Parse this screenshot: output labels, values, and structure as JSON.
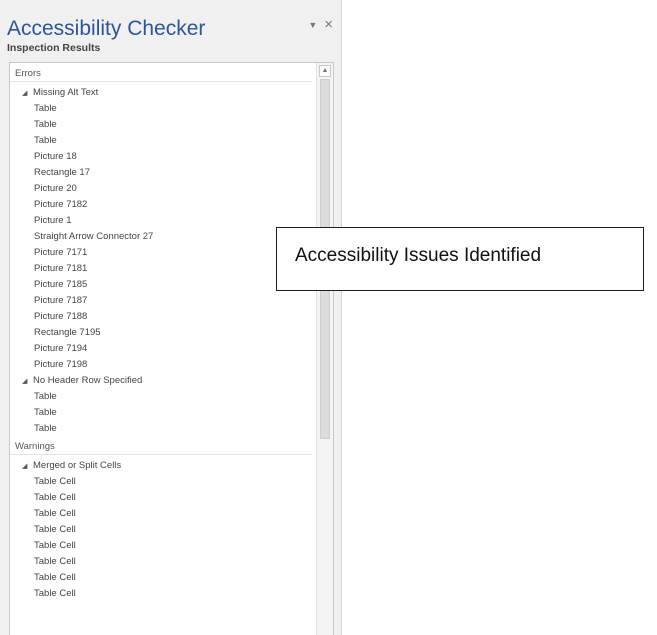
{
  "pane": {
    "title": "Accessibility Checker",
    "dropdown_icon": "chevron-down-icon",
    "close_icon": "close-icon",
    "subtitle": "Inspection Results"
  },
  "errors": {
    "header": "Errors",
    "groups": [
      {
        "label": "Missing Alt Text",
        "items": [
          "Table",
          "Table",
          "Table",
          "Picture 18",
          "Rectangle 17",
          "Picture 20",
          "Picture 7182",
          "Picture 1",
          "Straight Arrow Connector 27",
          "Picture 7171",
          "Picture 7181",
          "Picture 7185",
          "Picture 7187",
          "Picture 7188",
          "Rectangle 7195",
          "Picture 7194",
          "Picture 7198"
        ]
      },
      {
        "label": "No Header Row Specified",
        "items": [
          "Table",
          "Table",
          "Table"
        ]
      }
    ]
  },
  "warnings": {
    "header": "Warnings",
    "groups": [
      {
        "label": "Merged or Split Cells",
        "items": [
          "Table Cell",
          "Table Cell",
          "Table Cell",
          "Table Cell",
          "Table Cell",
          "Table Cell",
          "Table Cell",
          "Table Cell"
        ]
      }
    ]
  },
  "callout": {
    "text": "Accessibility Issues Identified"
  },
  "colors": {
    "title": "#2b579a",
    "pane_bg": "#f0f0f0"
  }
}
